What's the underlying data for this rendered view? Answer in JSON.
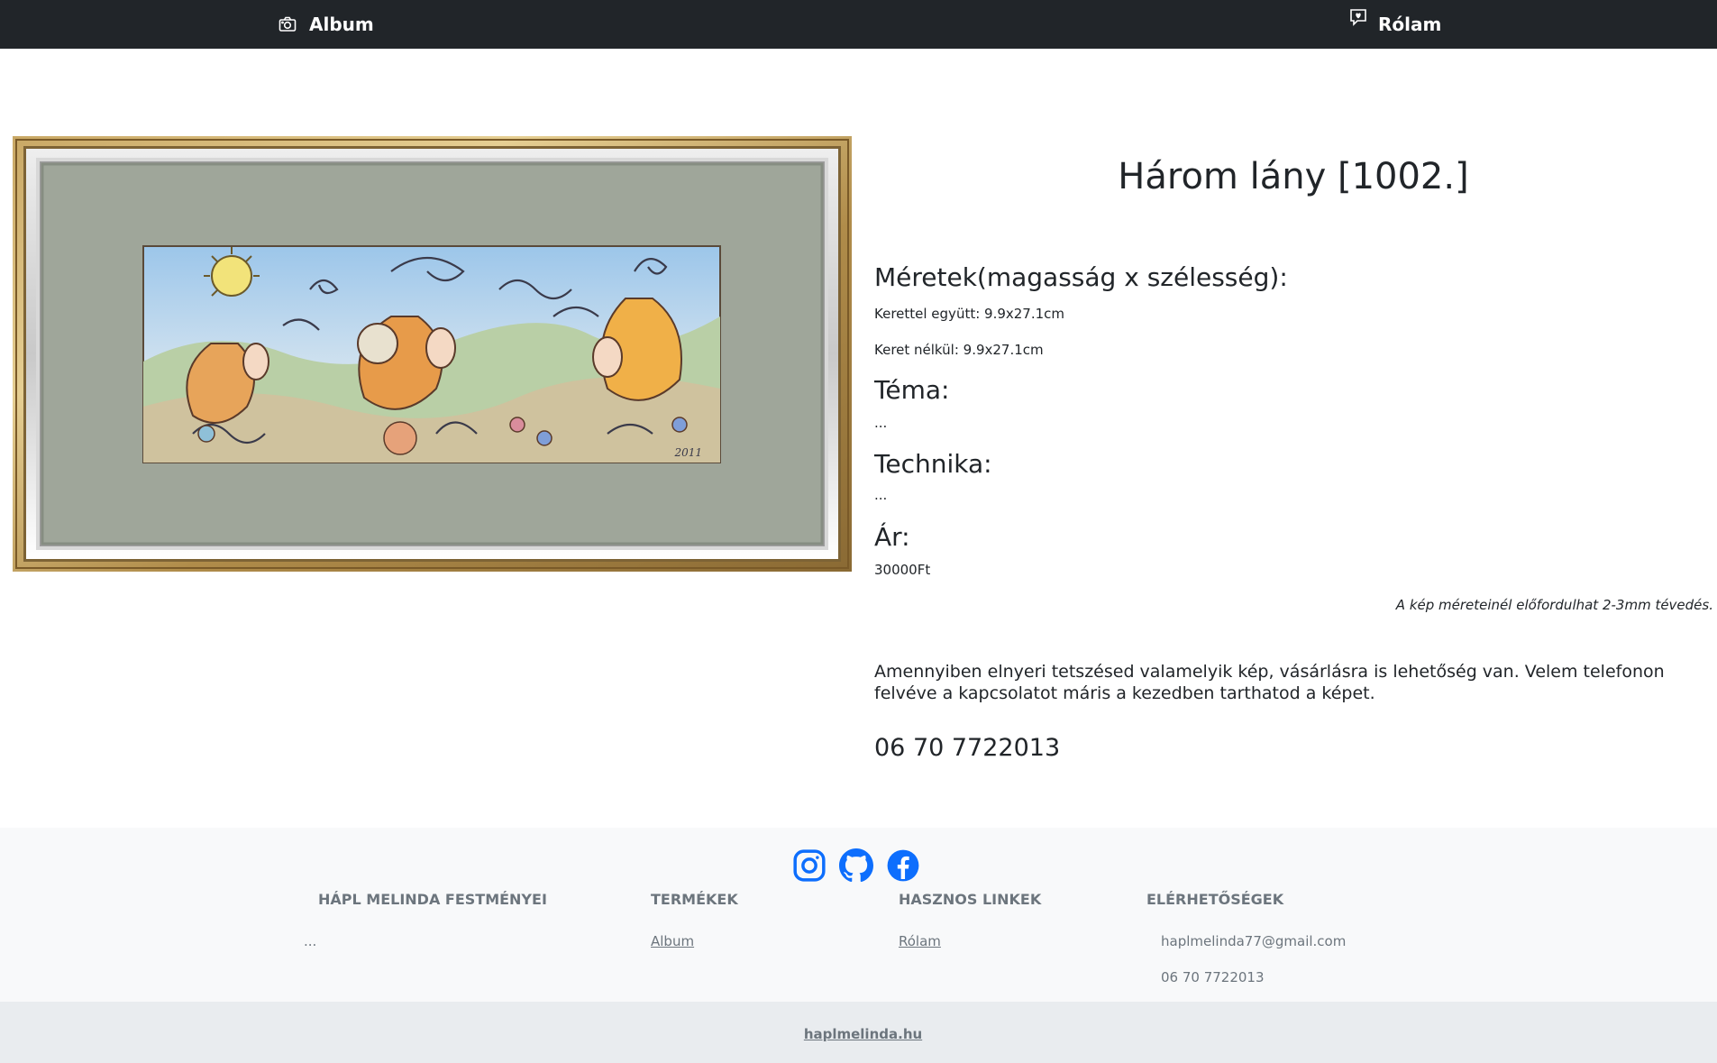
{
  "nav": {
    "album_label": "Album",
    "about_label": "Rólam"
  },
  "painting": {
    "signature": "2011"
  },
  "details": {
    "title": "Három lány [1002.]",
    "dimensions_heading": "Méretek(magasság x szélesség):",
    "with_frame": "Kerettel együtt: 9.9x27.1cm",
    "without_frame": "Keret nélkül: 9.9x27.1cm",
    "theme_heading": "Téma:",
    "theme_value": "...",
    "technique_heading": "Technika:",
    "technique_value": "...",
    "price_heading": "Ár:",
    "price_value": "30000Ft",
    "disclaimer": "A kép méreteinél előfordulhat 2-3mm tévedés.",
    "contact_text": "Amennyiben elnyeri tetszésed valamelyik kép, vásárlásra is lehetőség van. Velem telefonon felvéve a kapcsolatot máris a kezedben tarthatod a képet.",
    "phone": "06 70 7722013"
  },
  "footer": {
    "col1_heading": "HÁPL MELINDA FESTMÉNYEI",
    "col1_text": "...",
    "col2_heading": "TERMÉKEK",
    "col2_link": "Album",
    "col3_heading": "HASZNOS LINKEK",
    "col3_link": "Rólam",
    "col4_heading": "ELÉRHETŐSÉGEK",
    "email": "haplmelinda77@gmail.com",
    "phone": "06 70 7722013",
    "site": "haplmelinda.hu"
  },
  "colors": {
    "navbar": "#212529",
    "social_blue": "#0d6efd",
    "footer_bg": "#f8f9fa",
    "bottom_bar_bg": "#e9ecef",
    "muted_text": "#6c757d"
  }
}
